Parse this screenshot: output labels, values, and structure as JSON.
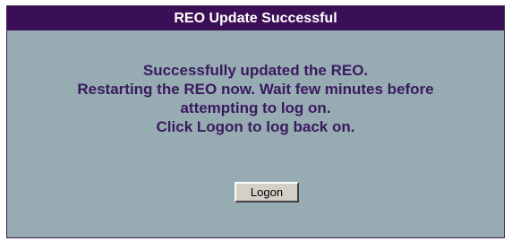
{
  "dialog": {
    "title": "REO Update Successful",
    "messages": [
      "Successfully updated the REO.",
      "Restarting the REO now. Wait few minutes before",
      "attempting to log on.",
      "Click Logon to log back on."
    ],
    "logon_label": "Logon"
  },
  "colors": {
    "titlebar": "#3b0f55",
    "panel_background": "#96abb2",
    "message_text": "#3a1a5e"
  }
}
